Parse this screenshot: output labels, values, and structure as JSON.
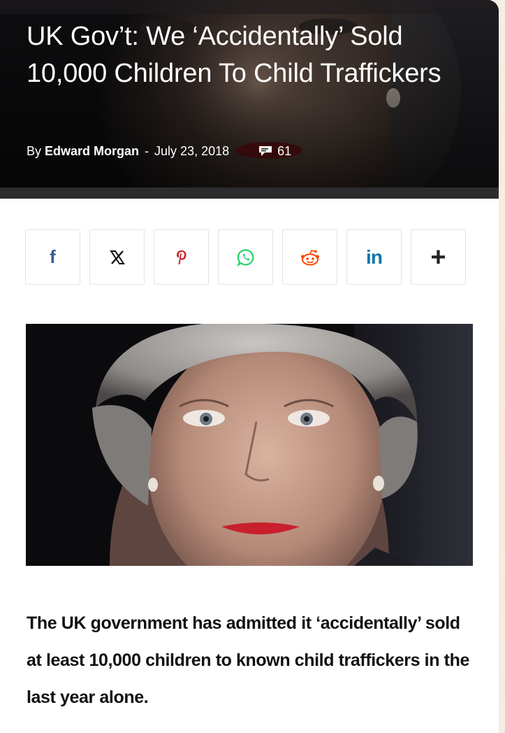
{
  "article": {
    "title": "UK Gov’t: We ‘Accidentally’ Sold 10,000 Children To Child Traffickers",
    "byline_prefix": "By",
    "author": "Edward Morgan",
    "separator": "-",
    "date": "July 23, 2018",
    "comment_count": "61",
    "comment_icon": "speech-bubble-icon",
    "lede": "The UK government has admitted it ‘accidentally’ sold at least 10,000 children to known child traffickers in the last year alone."
  },
  "share": {
    "buttons": [
      {
        "icon": "facebook-icon",
        "glyph": "f"
      },
      {
        "icon": "x-icon",
        "glyph": "X"
      },
      {
        "icon": "pinterest-icon",
        "glyph": "P"
      },
      {
        "icon": "whatsapp-icon",
        "glyph": ""
      },
      {
        "icon": "reddit-icon",
        "glyph": ""
      },
      {
        "icon": "linkedin-icon",
        "glyph": "in"
      },
      {
        "icon": "more-share-icon",
        "glyph": "+"
      }
    ]
  },
  "colors": {
    "facebook": "#3b5998",
    "pinterest": "#cb2027",
    "whatsapp": "#25d366",
    "reddit": "#ff4500",
    "linkedin": "#0e76a8",
    "lipstick": "#c8202c"
  }
}
